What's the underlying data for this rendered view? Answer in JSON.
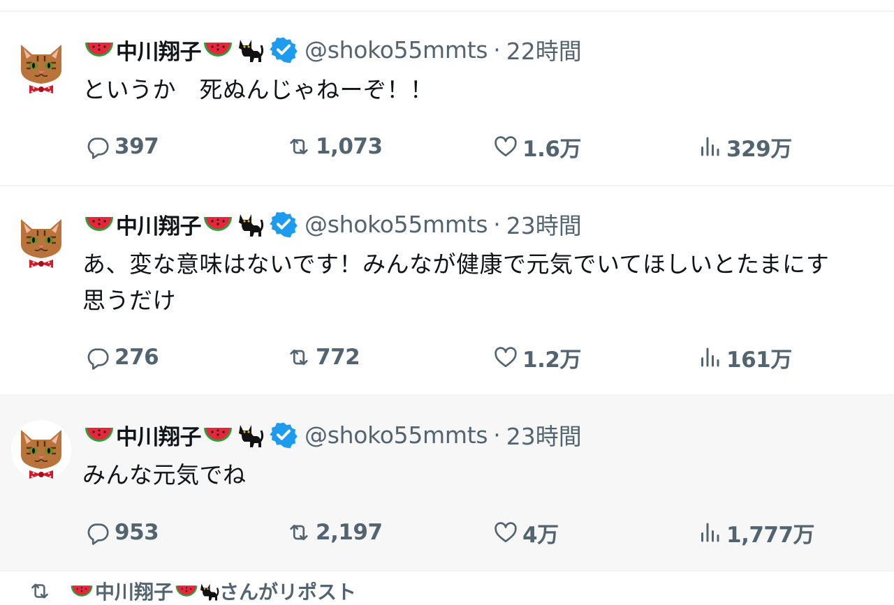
{
  "colors": {
    "accent": "#1d9bf0",
    "muted": "#536471",
    "text": "#0f1419",
    "divider": "#eff3f4",
    "highlight_bg": "#f7f7f7"
  },
  "tweets": [
    {
      "author": "中川翔子",
      "handle": "@shoko55mmts",
      "separator": "·",
      "time": "22時間",
      "text": "というか　死ぬんじゃねーぞ！！",
      "replies": "397",
      "reposts": "1,073",
      "likes": "1.6万",
      "views": "329万",
      "avatar_icon": "cat-face-avatar",
      "badge_icon": "verified-badge-icon"
    },
    {
      "author": "中川翔子",
      "handle": "@shoko55mmts",
      "separator": "·",
      "time": "23時間",
      "text": "あ、変な意味はないです！みんなが健康で元気でいてほしいとたまにす\n思うだけ",
      "replies": "276",
      "reposts": "772",
      "likes": "1.2万",
      "views": "161万",
      "avatar_icon": "cat-face-avatar",
      "badge_icon": "verified-badge-icon"
    },
    {
      "author": "中川翔子",
      "handle": "@shoko55mmts",
      "separator": "·",
      "time": "23時間",
      "text": "みんな元気でね",
      "replies": "953",
      "reposts": "2,197",
      "likes": "4万",
      "views": "1,777万",
      "avatar_icon": "cat-face-avatar",
      "badge_icon": "verified-badge-icon"
    }
  ],
  "footer": {
    "text": "中川翔子",
    "suffix": "さんがリポスト"
  }
}
